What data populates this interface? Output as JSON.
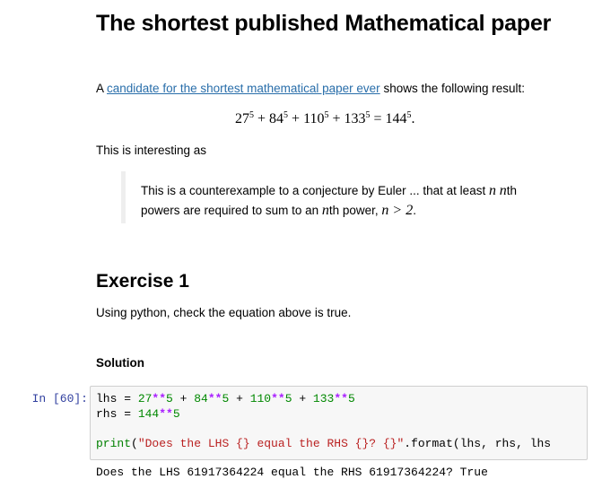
{
  "title": "The shortest published Mathematical paper",
  "intro": {
    "prefix": "A ",
    "link_text": "candidate for the shortest mathematical paper ever",
    "suffix": " shows the following result:"
  },
  "equation": {
    "b1": "27",
    "b2": "84",
    "b3": "110",
    "b4": "133",
    "b5": "144",
    "exp": "5",
    "plus": " + ",
    "equals": " = ",
    "end": "."
  },
  "interesting": "This is interesting as",
  "quote": {
    "line1_text": "This is a counterexample to a conjecture by Euler ... that at least ",
    "line1_n1": "n",
    "line1_n2": "n",
    "line1_th": "th",
    "line2_text": "powers are required to sum to an ",
    "line2_n": "n",
    "line2_th": "th power, ",
    "line2_ineq": "n > 2",
    "line2_end": "."
  },
  "exercise": {
    "heading": "Exercise 1",
    "text": "Using python, check the equation above is true.",
    "solution_label": "Solution"
  },
  "cell": {
    "prompt": "In [60]:",
    "code": {
      "l1_var": "lhs",
      "l1_eq": " = ",
      "l1_a": "27",
      "l1_b": "84",
      "l1_c": "110",
      "l1_d": "133",
      "pow": "**",
      "five": "5",
      "plus": " + ",
      "l2_var": "rhs",
      "l2_eq": " = ",
      "l2_a": "144",
      "l4_fn": "print",
      "l4_open": "(",
      "l4_str": "\"Does the LHS {} equal the RHS {}? {}\"",
      "l4_rest": ".format(lhs, rhs, lhs"
    },
    "output": "Does the LHS 61917364224 equal the RHS 61917364224? True"
  }
}
